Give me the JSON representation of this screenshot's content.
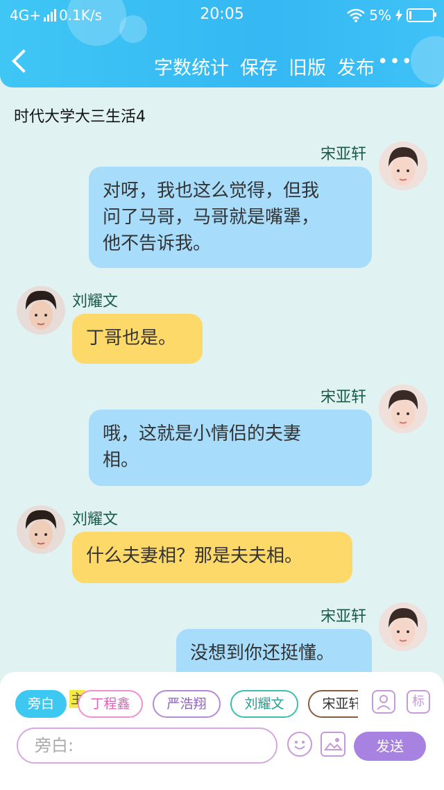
{
  "status_bar": {
    "network": "4G+",
    "speed": "0.1K/s",
    "time": "20:05",
    "battery": "5%"
  },
  "nav": {
    "items": [
      "字数统计",
      "保存",
      "旧版",
      "发布"
    ],
    "more": "•••"
  },
  "story_title": "时代大学大三生活4",
  "messages": [
    {
      "speaker": "宋亚轩",
      "side": "right",
      "text_lines": [
        "对呀，我也这么觉得，但我",
        "问了马哥，马哥就是嘴犟，",
        "他不告诉我。"
      ]
    },
    {
      "speaker": "刘耀文",
      "side": "left",
      "text_lines": [
        "丁哥也是。"
      ]
    },
    {
      "speaker": "宋亚轩",
      "side": "right",
      "text_lines": [
        "哦，这就是小情侣的夫妻",
        "相。"
      ]
    },
    {
      "speaker": "刘耀文",
      "side": "left",
      "text_lines": [
        "什么夫妻相？那是夫夫相。"
      ]
    },
    {
      "speaker": "宋亚轩",
      "side": "right",
      "text_lines": [
        "没想到你还挺懂。"
      ]
    }
  ],
  "bottom_bar": {
    "chips": [
      "旁白",
      "丁程鑫",
      "严浩翔",
      "刘耀文",
      "宋亚轩"
    ],
    "highlight_mark": "主",
    "tool_label": "标",
    "input_placeholder": "旁白:",
    "send_label": "发送"
  },
  "colors": {
    "header": "#3fc6f5",
    "background": "#e0f2f2",
    "right_bubble": "#a7dcfb",
    "left_bubble": "#fdd96a",
    "send": "#a882e0"
  }
}
